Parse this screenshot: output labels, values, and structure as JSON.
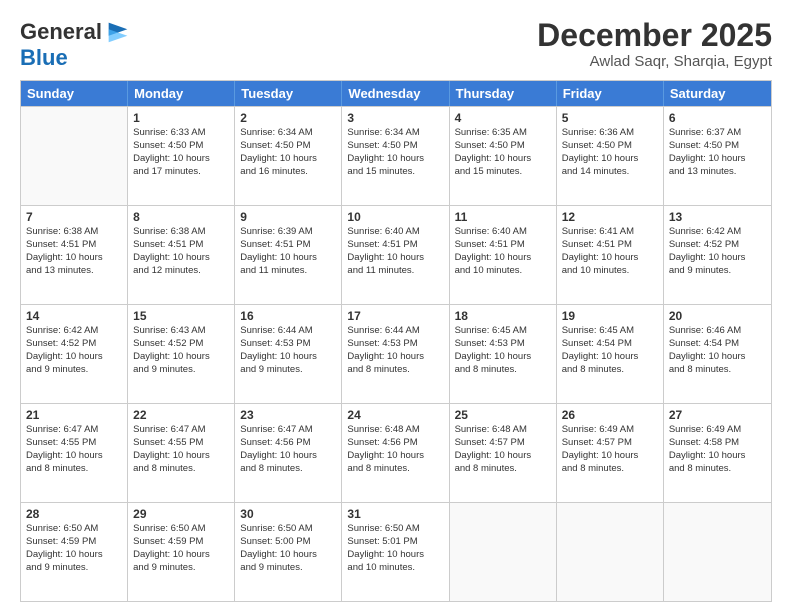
{
  "logo": {
    "line1": "General",
    "line2": "Blue"
  },
  "title": "December 2025",
  "subtitle": "Awlad Saqr, Sharqia, Egypt",
  "days": [
    "Sunday",
    "Monday",
    "Tuesday",
    "Wednesday",
    "Thursday",
    "Friday",
    "Saturday"
  ],
  "weeks": [
    [
      {
        "day": null,
        "info": ""
      },
      {
        "day": "1",
        "info": "Sunrise: 6:33 AM\nSunset: 4:50 PM\nDaylight: 10 hours\nand 17 minutes."
      },
      {
        "day": "2",
        "info": "Sunrise: 6:34 AM\nSunset: 4:50 PM\nDaylight: 10 hours\nand 16 minutes."
      },
      {
        "day": "3",
        "info": "Sunrise: 6:34 AM\nSunset: 4:50 PM\nDaylight: 10 hours\nand 15 minutes."
      },
      {
        "day": "4",
        "info": "Sunrise: 6:35 AM\nSunset: 4:50 PM\nDaylight: 10 hours\nand 15 minutes."
      },
      {
        "day": "5",
        "info": "Sunrise: 6:36 AM\nSunset: 4:50 PM\nDaylight: 10 hours\nand 14 minutes."
      },
      {
        "day": "6",
        "info": "Sunrise: 6:37 AM\nSunset: 4:50 PM\nDaylight: 10 hours\nand 13 minutes."
      }
    ],
    [
      {
        "day": "7",
        "info": "Sunrise: 6:38 AM\nSunset: 4:51 PM\nDaylight: 10 hours\nand 13 minutes."
      },
      {
        "day": "8",
        "info": "Sunrise: 6:38 AM\nSunset: 4:51 PM\nDaylight: 10 hours\nand 12 minutes."
      },
      {
        "day": "9",
        "info": "Sunrise: 6:39 AM\nSunset: 4:51 PM\nDaylight: 10 hours\nand 11 minutes."
      },
      {
        "day": "10",
        "info": "Sunrise: 6:40 AM\nSunset: 4:51 PM\nDaylight: 10 hours\nand 11 minutes."
      },
      {
        "day": "11",
        "info": "Sunrise: 6:40 AM\nSunset: 4:51 PM\nDaylight: 10 hours\nand 10 minutes."
      },
      {
        "day": "12",
        "info": "Sunrise: 6:41 AM\nSunset: 4:51 PM\nDaylight: 10 hours\nand 10 minutes."
      },
      {
        "day": "13",
        "info": "Sunrise: 6:42 AM\nSunset: 4:52 PM\nDaylight: 10 hours\nand 9 minutes."
      }
    ],
    [
      {
        "day": "14",
        "info": "Sunrise: 6:42 AM\nSunset: 4:52 PM\nDaylight: 10 hours\nand 9 minutes."
      },
      {
        "day": "15",
        "info": "Sunrise: 6:43 AM\nSunset: 4:52 PM\nDaylight: 10 hours\nand 9 minutes."
      },
      {
        "day": "16",
        "info": "Sunrise: 6:44 AM\nSunset: 4:53 PM\nDaylight: 10 hours\nand 9 minutes."
      },
      {
        "day": "17",
        "info": "Sunrise: 6:44 AM\nSunset: 4:53 PM\nDaylight: 10 hours\nand 8 minutes."
      },
      {
        "day": "18",
        "info": "Sunrise: 6:45 AM\nSunset: 4:53 PM\nDaylight: 10 hours\nand 8 minutes."
      },
      {
        "day": "19",
        "info": "Sunrise: 6:45 AM\nSunset: 4:54 PM\nDaylight: 10 hours\nand 8 minutes."
      },
      {
        "day": "20",
        "info": "Sunrise: 6:46 AM\nSunset: 4:54 PM\nDaylight: 10 hours\nand 8 minutes."
      }
    ],
    [
      {
        "day": "21",
        "info": "Sunrise: 6:47 AM\nSunset: 4:55 PM\nDaylight: 10 hours\nand 8 minutes."
      },
      {
        "day": "22",
        "info": "Sunrise: 6:47 AM\nSunset: 4:55 PM\nDaylight: 10 hours\nand 8 minutes."
      },
      {
        "day": "23",
        "info": "Sunrise: 6:47 AM\nSunset: 4:56 PM\nDaylight: 10 hours\nand 8 minutes."
      },
      {
        "day": "24",
        "info": "Sunrise: 6:48 AM\nSunset: 4:56 PM\nDaylight: 10 hours\nand 8 minutes."
      },
      {
        "day": "25",
        "info": "Sunrise: 6:48 AM\nSunset: 4:57 PM\nDaylight: 10 hours\nand 8 minutes."
      },
      {
        "day": "26",
        "info": "Sunrise: 6:49 AM\nSunset: 4:57 PM\nDaylight: 10 hours\nand 8 minutes."
      },
      {
        "day": "27",
        "info": "Sunrise: 6:49 AM\nSunset: 4:58 PM\nDaylight: 10 hours\nand 8 minutes."
      }
    ],
    [
      {
        "day": "28",
        "info": "Sunrise: 6:50 AM\nSunset: 4:59 PM\nDaylight: 10 hours\nand 9 minutes."
      },
      {
        "day": "29",
        "info": "Sunrise: 6:50 AM\nSunset: 4:59 PM\nDaylight: 10 hours\nand 9 minutes."
      },
      {
        "day": "30",
        "info": "Sunrise: 6:50 AM\nSunset: 5:00 PM\nDaylight: 10 hours\nand 9 minutes."
      },
      {
        "day": "31",
        "info": "Sunrise: 6:50 AM\nSunset: 5:01 PM\nDaylight: 10 hours\nand 10 minutes."
      },
      {
        "day": null,
        "info": ""
      },
      {
        "day": null,
        "info": ""
      },
      {
        "day": null,
        "info": ""
      }
    ]
  ]
}
